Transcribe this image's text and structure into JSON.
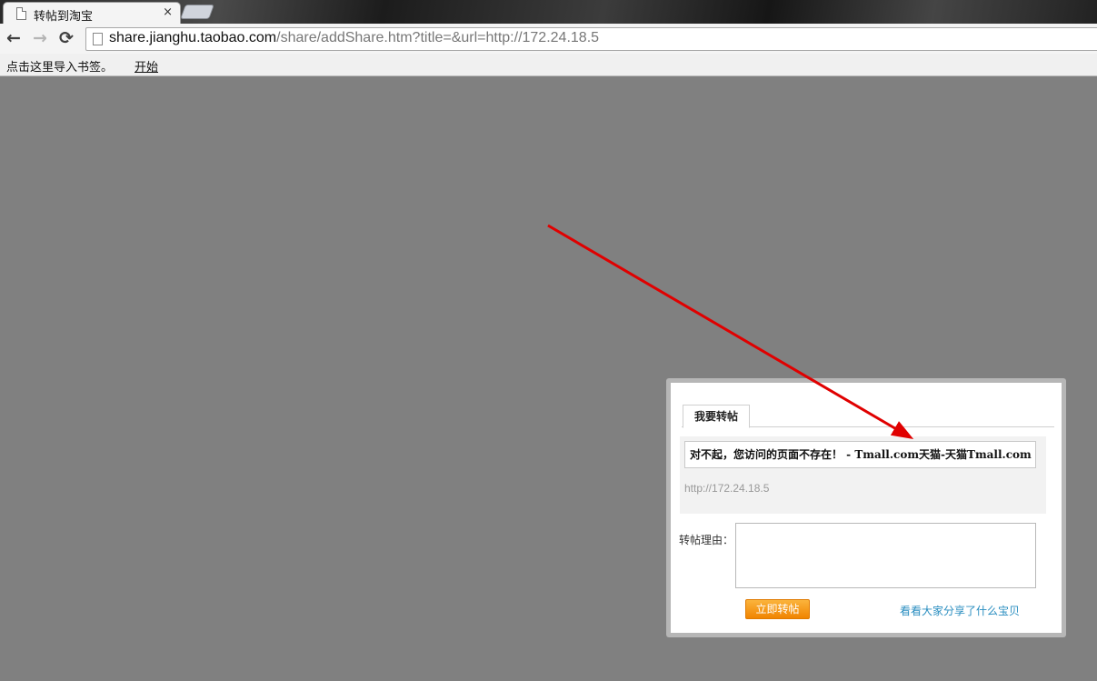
{
  "browser": {
    "tab_title": "转帖到淘宝",
    "tab_close": "×",
    "url_host": "share.jianghu.taobao.com",
    "url_path": "/share/addShare.htm?title=&url=http://172.24.18.5",
    "back_icon": "←",
    "forward_icon": "→",
    "reload_icon": "⟳"
  },
  "bookmarks_bar": {
    "prompt": "点击这里导入书签。",
    "link": "开始"
  },
  "share_dialog": {
    "tab_label": "我要转帖",
    "title_value": "对不起，您访问的页面不存在！ - Tmall.com天猫-天猫Tmall.com",
    "share_url": "http://172.24.18.5",
    "reason_label": "转帖理由：",
    "reason_value": "",
    "submit_label": "立即转帖",
    "see_link": "看看大家分享了什么宝贝"
  },
  "annotation": {
    "arrow_color": "#e00000"
  }
}
